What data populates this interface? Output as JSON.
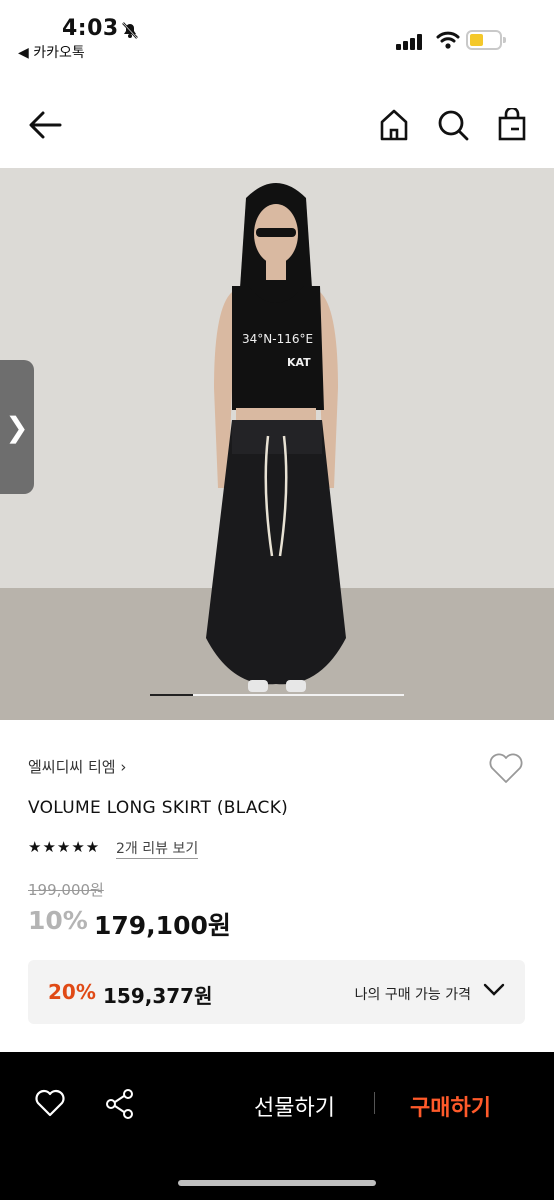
{
  "status": {
    "time": "4:03",
    "back_app": "◀ 카카오톡"
  },
  "product": {
    "brand": "엘씨디씨 티엠 ›",
    "title": "VOLUME LONG SKIRT (BLACK)",
    "rating_stars": "★★★★★",
    "rating_value": 4.5,
    "review_link": "2개 리뷰 보기",
    "original_price": "199,000원",
    "discount": "10%",
    "price": "179,100원"
  },
  "image": {
    "shirt_text": "34°N-116°E",
    "shirt_brand": "KAT",
    "carousel_progress": 0.17
  },
  "coupon": {
    "percent": "20%",
    "amount": "159,377원",
    "label": "나의 구매 가능 가격"
  },
  "bottom_bar": {
    "gift_label": "선물하기",
    "buy_label": "구매하기"
  },
  "colors": {
    "accent": "#e04a16",
    "buy": "#ff5a2a"
  }
}
